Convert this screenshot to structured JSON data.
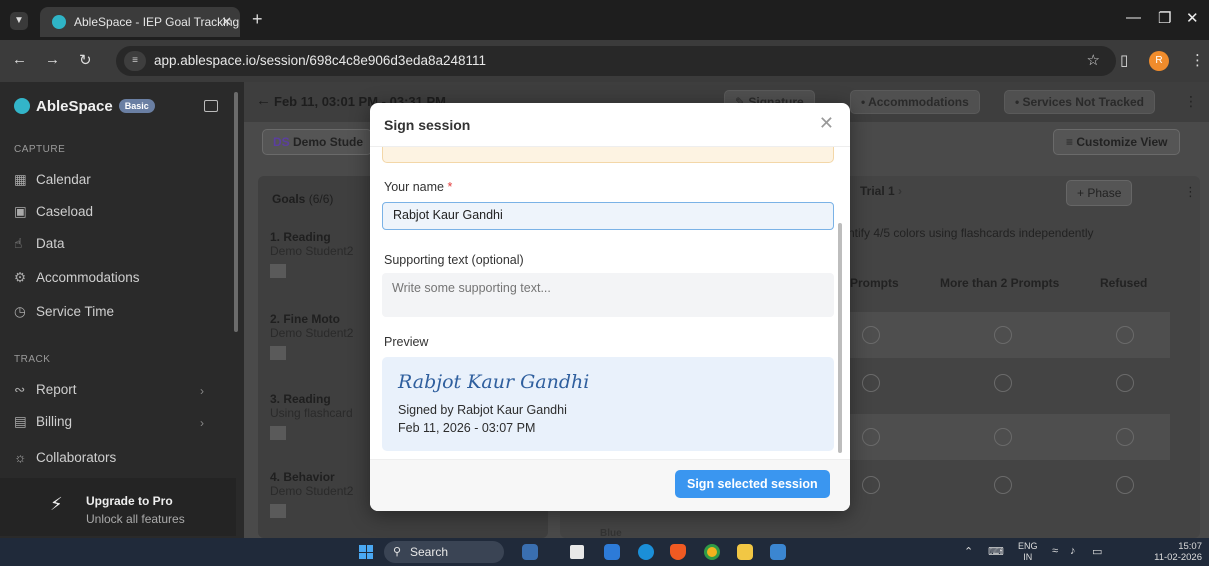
{
  "browser": {
    "tab_title": "AbleSpace - IEP Goal Tracking /",
    "url": "app.ablespace.io/session/698c4c8e906d3eda8a248111",
    "profile_initial": "R"
  },
  "sidebar": {
    "brand": "AbleSpace",
    "plan_badge": "Basic",
    "section_capture": "CAPTURE",
    "section_track": "TRACK",
    "items": [
      {
        "label": "Calendar"
      },
      {
        "label": "Caseload"
      },
      {
        "label": "Data"
      },
      {
        "label": "Accommodations"
      },
      {
        "label": "Service Time"
      },
      {
        "label": "Report"
      },
      {
        "label": "Billing"
      },
      {
        "label": "Collaborators"
      }
    ],
    "upgrade_title": "Upgrade to Pro",
    "upgrade_sub": "Unlock all features"
  },
  "header": {
    "session_title": "Feb 11, 03:01 PM - 03:31 PM",
    "signature": "Signature",
    "accommodations": "Accommodations",
    "services": "Services Not Tracked",
    "student_initials": "DS",
    "student_name": "Demo Stude",
    "customize": "Customize View"
  },
  "goals": {
    "title": "Goals",
    "count": "(6/6)",
    "items": [
      {
        "name": "1. Reading",
        "sub": "Demo Student2"
      },
      {
        "name": "2. Fine Moto",
        "sub": "Demo Student2"
      },
      {
        "name": "3. Reading",
        "sub": "Using flashcard"
      },
      {
        "name": "4. Behavior",
        "sub": "Demo Student2"
      }
    ]
  },
  "trial": {
    "label": "Trial 1",
    "phase_button": "+ Phase",
    "goal_desc": "ntify 4/5 colors using flashcards independently",
    "columns": [
      "Prompts",
      "More than 2 Prompts",
      "Refused"
    ],
    "row_label_partial": "Blue"
  },
  "modal": {
    "title": "Sign session",
    "name_label": "Your name",
    "name_value": "Rabjot Kaur Gandhi",
    "support_label": "Supporting text (optional)",
    "support_placeholder": "Write some supporting text...",
    "preview_label": "Preview",
    "signature_script": "Rabjot Kaur Gandhi",
    "signed_by": "Signed by Rabjot Kaur Gandhi",
    "signed_date": "Feb 11, 2026 - 03:07 PM",
    "submit": "Sign selected session"
  },
  "taskbar": {
    "search": "Search",
    "lang_top": "ENG",
    "lang_bottom": "IN",
    "time": "15:07",
    "date": "11-02-2026"
  },
  "colors": {
    "accent": "#3a96f0",
    "brand": "#33b5c9",
    "required": "#e23b3b"
  }
}
